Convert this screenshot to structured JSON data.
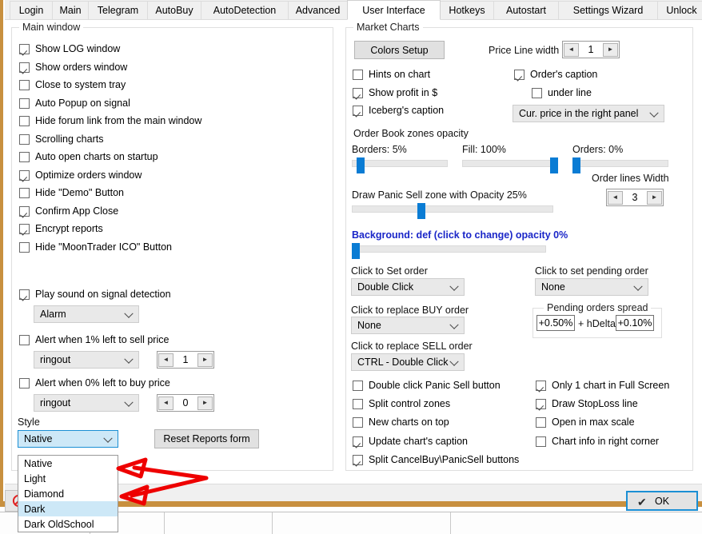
{
  "tabs": [
    {
      "label": "Login",
      "active": false
    },
    {
      "label": "Main",
      "active": false
    },
    {
      "label": "Telegram",
      "active": false
    },
    {
      "label": "AutoBuy",
      "active": false
    },
    {
      "label": "AutoDetection",
      "active": false
    },
    {
      "label": "Advanced",
      "active": false
    },
    {
      "label": "User Interface",
      "active": true
    },
    {
      "label": "Hotkeys",
      "active": false
    },
    {
      "label": "Autostart",
      "active": false
    },
    {
      "label": "Settings Wizard",
      "active": false
    },
    {
      "label": "Unlock",
      "active": false
    }
  ],
  "left_panel": {
    "title": "Main window",
    "checkboxes": [
      {
        "label": "Show LOG window",
        "checked": true
      },
      {
        "label": "Show orders window",
        "checked": true
      },
      {
        "label": "Close to system tray",
        "checked": false
      },
      {
        "label": "Auto Popup on signal",
        "checked": false
      },
      {
        "label": "Hide forum link from the main window",
        "checked": false
      },
      {
        "label": "Scrolling charts",
        "checked": false
      },
      {
        "label": "Auto open charts on startup",
        "checked": false
      },
      {
        "label": "Optimize orders window",
        "checked": true
      },
      {
        "label": "Hide \"Demo\" Button",
        "checked": false
      },
      {
        "label": "Confirm App Close",
        "checked": true
      },
      {
        "label": "Encrypt reports",
        "checked": true
      },
      {
        "label": "Hide \"MoonTrader ICO\" Button",
        "checked": false
      }
    ],
    "play_sound": {
      "label": "Play sound on signal detection",
      "checked": true,
      "sound": "Alarm"
    },
    "alert_sell": {
      "label": "Alert when 1% left to sell price",
      "checked": false,
      "sound": "ringout",
      "value": "1"
    },
    "alert_buy": {
      "label": "Alert when 0% left to buy price",
      "checked": false,
      "sound": "ringout",
      "value": "0"
    },
    "style": {
      "label": "Style",
      "value": "Native"
    },
    "reset_button": "Reset Reports form",
    "style_options": [
      {
        "label": "Native",
        "selected": false
      },
      {
        "label": "Light",
        "selected": false
      },
      {
        "label": "Diamond",
        "selected": false
      },
      {
        "label": "Dark",
        "selected": true
      },
      {
        "label": "Dark OldSchool",
        "selected": false
      }
    ]
  },
  "right_panel": {
    "title": "Market Charts",
    "colors_setup_button": "Colors Setup",
    "price_line_width": {
      "label": "Price Line width",
      "value": "1"
    },
    "checks_col1": [
      {
        "label": "Hints on chart",
        "checked": false
      },
      {
        "label": "Show profit in $",
        "checked": true
      },
      {
        "label": "Iceberg's caption",
        "checked": true
      }
    ],
    "orders_caption": {
      "label": "Order's caption",
      "checked": true
    },
    "under_line": {
      "label": "under line",
      "checked": false
    },
    "price_panel_combo": "Cur. price in the right panel",
    "order_book": {
      "title": "Order Book zones opacity",
      "borders": {
        "label": "Borders: 5%",
        "percent": 5
      },
      "fill": {
        "label": "Fill: 100%",
        "percent": 100
      },
      "orders": {
        "label": "Orders: 0%",
        "percent": 0
      }
    },
    "order_lines_width": {
      "label": "Order lines Width",
      "value": "3"
    },
    "panic_sell": {
      "label": "Draw Panic Sell zone with Opacity 25%",
      "percent": 25
    },
    "background": {
      "label": "Background: def (click to change) opacity 0%",
      "percent": 0
    },
    "click_set_order": {
      "label": "Click to Set order",
      "value": "Double Click"
    },
    "click_replace_buy": {
      "label": "Click to replace BUY order",
      "value": "None"
    },
    "click_replace_sell": {
      "label": "Click to replace SELL order",
      "value": "CTRL - Double Click"
    },
    "click_pending": {
      "label": "Click to set pending order",
      "value": "None"
    },
    "pending_spread": {
      "title": "Pending orders spread",
      "first": "+0.50%",
      "mid": "+ hDelta*",
      "second": "+0.10%"
    },
    "checks_bottom_left": [
      {
        "label": "Double click Panic Sell button",
        "checked": false
      },
      {
        "label": "Split control zones",
        "checked": false
      },
      {
        "label": "New charts on top",
        "checked": false
      },
      {
        "label": "Update chart's caption",
        "checked": true
      },
      {
        "label": "Split CancelBuy\\PanicSell buttons",
        "checked": true
      }
    ],
    "checks_bottom_right": [
      {
        "label": "Only 1 chart in Full Screen",
        "checked": true
      },
      {
        "label": "Draw StopLoss line",
        "checked": true
      },
      {
        "label": "Open in max scale",
        "checked": false
      },
      {
        "label": "Chart info in right corner",
        "checked": false
      }
    ]
  },
  "footer": {
    "ok_label": "OK"
  },
  "colors": {
    "accent_blue": "#0a7cd4",
    "focus_blue": "#1b8fd4",
    "link_blue": "#1a26c8",
    "annotation_red": "#ee0000",
    "window_orange": "#c8903f"
  }
}
